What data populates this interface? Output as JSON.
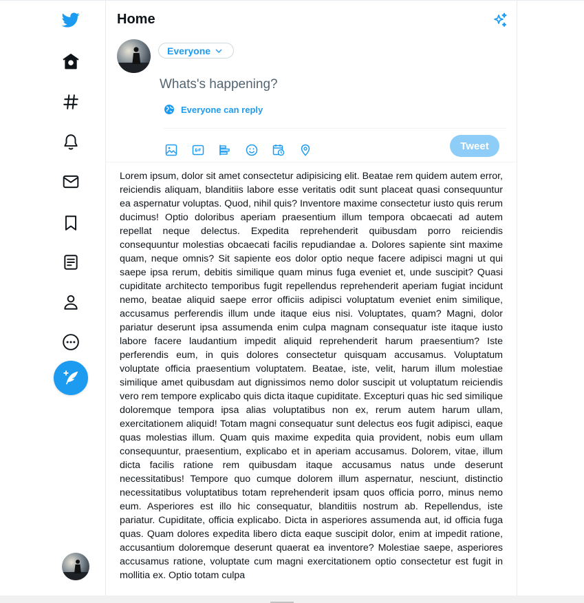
{
  "header": {
    "title": "Home"
  },
  "composer": {
    "audience_label": "Everyone",
    "placeholder": "Whats's happening?",
    "reply_setting": "Everyone can reply",
    "tweet_button": "Tweet"
  },
  "sidebar": {
    "icons": [
      "twitter-logo-icon",
      "home-icon",
      "hashtag-icon",
      "bell-icon",
      "mail-icon",
      "bookmark-icon",
      "list-icon",
      "profile-icon",
      "more-icon",
      "compose-icon"
    ]
  },
  "toolbar": {
    "icons": [
      "image-icon",
      "gif-icon",
      "poll-icon",
      "emoji-icon",
      "schedule-icon",
      "location-icon"
    ]
  },
  "colors": {
    "accent": "#1d9bf0",
    "tweet_disabled": "#8ecdf8",
    "border": "#e6ecf0"
  },
  "body_text": "Lorem ipsum, dolor sit amet consectetur adipisicing elit. Beatae rem quidem autem error, reiciendis aliquam, blanditiis labore esse veritatis odit sunt placeat quasi consequuntur ea aspernatur voluptas. Quod, nihil quis? Inventore maxime consectetur iusto quis rerum ducimus! Optio doloribus aperiam praesentium illum tempora obcaecati ad autem repellat neque delectus. Expedita reprehenderit quibusdam porro reiciendis consequuntur molestias obcaecati facilis repudiandae a. Dolores sapiente sint maxime quam, neque omnis? Sit sapiente eos dolor optio neque facere adipisci magni ut qui saepe ipsa rerum, debitis similique quam minus fuga eveniet et, unde suscipit? Quasi cupiditate architecto temporibus fugit repellendus reprehenderit aperiam fugiat incidunt nemo, beatae aliquid saepe error officiis adipisci voluptatum eveniet enim similique, accusamus perferendis illum unde itaque eius nisi. Voluptates, quam? Magni, dolor pariatur deserunt ipsa assumenda enim culpa magnam consequatur iste itaque iusto labore facere laudantium impedit aliquid reprehenderit harum praesentium? Iste perferendis eum, in quis dolores consectetur quisquam accusamus. Voluptatum voluptate officia praesentium voluptatem. Beatae, iste, velit, harum illum molestiae similique amet quibusdam aut dignissimos nemo dolor suscipit ut voluptatum reiciendis vero rem tempore explicabo quis dicta itaque cupiditate. Excepturi quas hic sed similique doloremque tempora ipsa alias voluptatibus non ex, rerum autem harum ullam, exercitationem aliquid! Totam magni consequatur sunt delectus eos fugit adipisci, eaque quas molestias illum. Quam quis maxime expedita quia provident, nobis eum ullam consequuntur, praesentium, explicabo et in aperiam accusamus. Dolorem, vitae, illum dicta facilis ratione rem quibusdam itaque accusamus natus unde deserunt necessitatibus! Tempore quo cumque dolorem illum aspernatur, nesciunt, distinctio necessitatibus voluptatibus totam reprehenderit ipsam quos officia porro, minus nemo eum. Asperiores est illo hic consequatur, blanditiis nostrum ab. Repellendus, iste pariatur. Cupiditate, officia explicabo. Dicta in asperiores assumenda aut, id officia fuga quas. Quam dolores expedita libero dicta eaque suscipit dolor, enim at impedit ratione, accusantium doloremque deserunt quaerat ea inventore? Molestiae saepe, asperiores accusamus ratione, voluptate cum magni exercitationem optio consectetur est fugit in mollitia ex. Optio totam culpa"
}
